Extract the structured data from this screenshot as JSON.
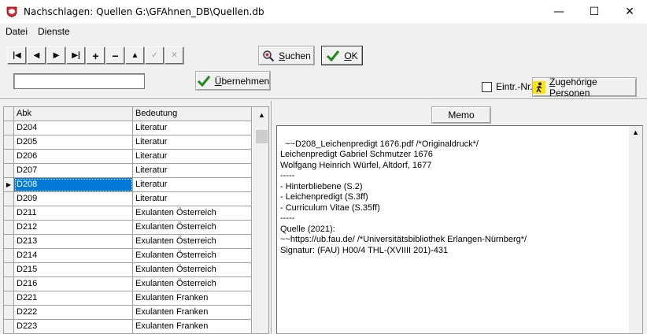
{
  "window": {
    "title": "Nachschlagen: Quellen   G:\\GFAhnen_DB\\Quellen.db",
    "minimize": "—",
    "maximize": "☐",
    "close": "✕"
  },
  "menu": [
    "Datei",
    "Dienste"
  ],
  "navigator": {
    "first": "|◀",
    "prior": "◀",
    "next": "▶",
    "last": "▶|",
    "insert": "+",
    "delete": "−",
    "edit": "▲",
    "post": "✓",
    "cancel": "✕"
  },
  "buttons": {
    "suchen_pre": "",
    "suchen_acc": "S",
    "suchen_rest": "uchen",
    "ok_acc": "O",
    "ok_rest": "K",
    "uebernehmen_acc": "Ü",
    "uebernehmen_rest": "bernehmen",
    "memo": "Memo",
    "zugehoerige_acc": "Z",
    "zugehoerige_rest": "ugehörige Personen"
  },
  "search_input": {
    "value": ""
  },
  "checkbox_label": "Eintr.-Nr.",
  "grid": {
    "columns": [
      "Abk",
      "Bedeutung"
    ],
    "rows": [
      [
        "D204",
        "Literatur"
      ],
      [
        "D205",
        "Literatur"
      ],
      [
        "D206",
        "Literatur"
      ],
      [
        "D207",
        "Literatur"
      ],
      [
        "D208",
        "Literatur"
      ],
      [
        "D209",
        "Literatur"
      ],
      [
        "D211",
        "Exulanten Österreich"
      ],
      [
        "D212",
        "Exulanten Österreich"
      ],
      [
        "D213",
        "Exulanten Österreich"
      ],
      [
        "D214",
        "Exulanten Österreich"
      ],
      [
        "D215",
        "Exulanten Österreich"
      ],
      [
        "D216",
        "Exulanten Österreich"
      ],
      [
        "D221",
        "Exulanten Franken"
      ],
      [
        "D222",
        "Exulanten Franken"
      ],
      [
        "D223",
        "Exulanten Franken"
      ]
    ],
    "selected_index": 4,
    "indicator": "▶"
  },
  "memo_text": "~~D208_Leichenpredigt 1676.pdf /*Originaldruck*/\nLeichenpredigt Gabriel Schmutzer 1676\nWolfgang Heinrich Würfel, Altdorf, 1677\n-----\n- Hinterbliebene (S.2)\n- Leichenpredigt (S.3ff)\n- Curriculum Vitae (S.35ff)\n-----\nQuelle (2021):\n~~https://ub.fau.de/ /*Universitätsbibliothek Erlangen-Nürnberg*/\nSignatur: (FAU) H00/4 THL-(XVIIII 201)-431",
  "colors": {
    "selection": "#0078d7",
    "ok_check": "#1a8a1a",
    "icon_red": "#d22c2c"
  }
}
